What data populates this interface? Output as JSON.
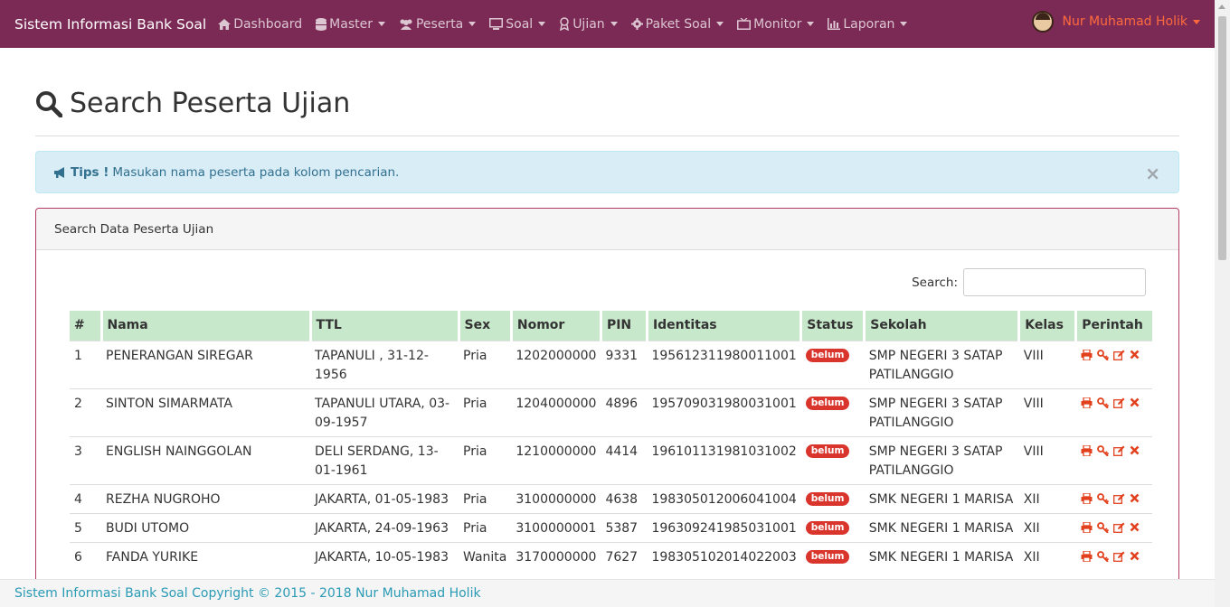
{
  "navbar": {
    "brand": "Sistem Informasi Bank Soal",
    "items": [
      {
        "label": "Dashboard",
        "icon": "home-icon",
        "dropdown": false
      },
      {
        "label": "Master",
        "icon": "database-icon",
        "dropdown": true
      },
      {
        "label": "Peserta",
        "icon": "users-icon",
        "dropdown": true
      },
      {
        "label": "Soal",
        "icon": "monitor-icon",
        "dropdown": true
      },
      {
        "label": "Ujian",
        "icon": "award-icon",
        "dropdown": true
      },
      {
        "label": "Paket Soal",
        "icon": "gear-icon",
        "dropdown": true
      },
      {
        "label": "Monitor",
        "icon": "tv-icon",
        "dropdown": true
      },
      {
        "label": "Laporan",
        "icon": "bar-chart-icon",
        "dropdown": true
      }
    ],
    "user_name": "Nur Muhamad Holik"
  },
  "page": {
    "title": "Search Peserta Ujian"
  },
  "alert": {
    "strong": "Tips !",
    "text": "Masukan nama peserta pada kolom pencarian.",
    "close": "×"
  },
  "panel": {
    "heading": "Search Data Peserta Ujian",
    "search_label": "Search:",
    "search_value": ""
  },
  "table": {
    "headers": [
      "#",
      "Nama",
      "TTL",
      "Sex",
      "Nomor",
      "PIN",
      "Identitas",
      "Status",
      "Sekolah",
      "Kelas",
      "Perintah"
    ],
    "rows": [
      {
        "no": "1",
        "nama": "PENERANGAN SIREGAR",
        "ttl": "TAPANULI , 31-12-1956",
        "sex": "Pria",
        "nomor": "1202000000",
        "pin": "9331",
        "identitas": "195612311980011001",
        "status": "belum",
        "sekolah": "SMP NEGERI 3 SATAP PATILANGGIO",
        "kelas": "VIII"
      },
      {
        "no": "2",
        "nama": "SINTON SIMARMATA",
        "ttl": "TAPANULI UTARA, 03-09-1957",
        "sex": "Pria",
        "nomor": "1204000000",
        "pin": "4896",
        "identitas": "195709031980031001",
        "status": "belum",
        "sekolah": "SMP NEGERI 3 SATAP PATILANGGIO",
        "kelas": "VIII"
      },
      {
        "no": "3",
        "nama": "ENGLISH NAINGGOLAN",
        "ttl": "DELI SERDANG, 13-01-1961",
        "sex": "Pria",
        "nomor": "1210000000",
        "pin": "4414",
        "identitas": "196101131981031002",
        "status": "belum",
        "sekolah": "SMP NEGERI 3 SATAP PATILANGGIO",
        "kelas": "VIII"
      },
      {
        "no": "4",
        "nama": "REZHA NUGROHO",
        "ttl": "JAKARTA, 01-05-1983",
        "sex": "Pria",
        "nomor": "3100000000",
        "pin": "4638",
        "identitas": "198305012006041004",
        "status": "belum",
        "sekolah": "SMK NEGERI 1 MARISA",
        "kelas": "XII"
      },
      {
        "no": "5",
        "nama": "BUDI UTOMO",
        "ttl": "JAKARTA, 24-09-1963",
        "sex": "Pria",
        "nomor": "3100000001",
        "pin": "5387",
        "identitas": "196309241985031001",
        "status": "belum",
        "sekolah": "SMK NEGERI 1 MARISA",
        "kelas": "XII"
      },
      {
        "no": "6",
        "nama": "FANDA YURIKE",
        "ttl": "JAKARTA, 10-05-1983",
        "sex": "Wanita",
        "nomor": "3170000000",
        "pin": "7627",
        "identitas": "198305102014022003",
        "status": "belum",
        "sekolah": "SMK NEGERI 1 MARISA",
        "kelas": "XII"
      }
    ]
  },
  "footer": {
    "text": "Sistem Informasi Bank Soal Copyright © 2015 - 2018 Nur Muhamad Holik"
  },
  "colors": {
    "navbar": "#7b2a55",
    "accent": "#ff6a3d",
    "header_row": "#c8e8cb",
    "badge": "#d9352c",
    "action_icon": "#e2401c"
  }
}
